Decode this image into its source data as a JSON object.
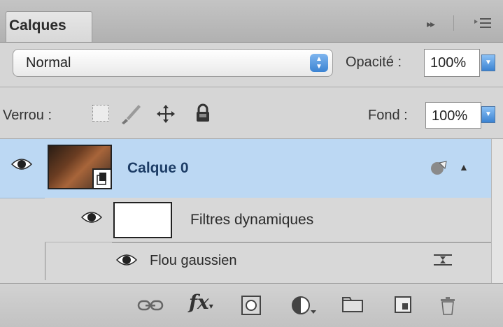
{
  "panel": {
    "tab_label": "Calques",
    "blend_mode": "Normal",
    "opacity_label": "Opacité :",
    "opacity_value": "100%",
    "lock_label": "Verrou :",
    "fill_label": "Fond :",
    "fill_value": "100%"
  },
  "layers": {
    "layer_name": "Calque 0",
    "smart_filters_label": "Filtres dynamiques",
    "filter_name": "Flou gaussien"
  },
  "colors": {
    "selected_row": "#bcd8f3",
    "panel_bg": "#d8d8d8",
    "accent_blue": "#3b83d2"
  },
  "icons": {
    "collapse": "double-chevron-icon",
    "panel_menu": "panel-menu-icon",
    "visibility": "eye-icon",
    "lock_transparent": "lock-transparent-icon",
    "lock_pixels": "brush-icon",
    "lock_position": "move-icon",
    "lock_all": "padlock-icon",
    "smart_object": "smart-object-icon",
    "filter_options": "filter-options-icon",
    "toolbar": [
      "link-icon",
      "fx-icon",
      "mask-icon",
      "adjustment-icon",
      "folder-icon",
      "new-layer-icon",
      "trash-icon"
    ]
  }
}
